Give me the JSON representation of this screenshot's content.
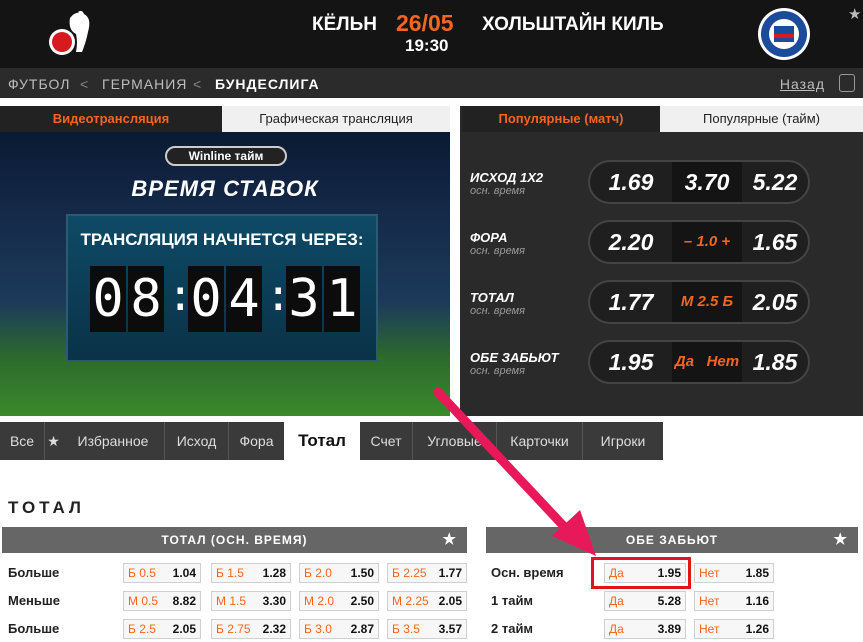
{
  "header": {
    "home_team": "КЁЛЬН",
    "away_team": "ХОЛЬШТАЙН КИЛЬ",
    "date": "26/05",
    "time": "19:30"
  },
  "breadcrumb": {
    "items": [
      "ФУТБОЛ",
      "ГЕРМАНИЯ",
      "БУНДЕСЛИГА"
    ],
    "back": "Назад"
  },
  "video": {
    "tabs": [
      "Видеотрансляция",
      "Графическая трансляция"
    ],
    "winline": "Winline тайм",
    "bet_time": "ВРЕМЯ СТАВОК",
    "countdown_label": "ТРАНСЛЯЦИЯ НАЧНЕТСЯ ЧЕРЕЗ:",
    "digits": [
      "0",
      "8",
      "0",
      "4",
      "3",
      "1"
    ],
    "colon": ":"
  },
  "popular": {
    "tabs": [
      "Популярные (матч)",
      "Популярные (тайм)"
    ],
    "markets": [
      {
        "name": "ИСХОД 1Х2",
        "sub": "осн. время",
        "left": "1.69",
        "mid": "3.70",
        "right": "5.22"
      },
      {
        "name": "ФОРА",
        "sub": "осн. время",
        "left": "2.20",
        "mid": "– 1.0 +",
        "right": "1.65"
      },
      {
        "name": "ТОТАЛ",
        "sub": "осн. время",
        "left": "1.77",
        "mid": "М 2.5 Б",
        "right": "2.05"
      },
      {
        "name": "ОБЕ ЗАБЬЮТ",
        "sub": "осн. время",
        "left": "1.95",
        "mid": "Да   Нет",
        "right": "1.85"
      }
    ]
  },
  "nav": {
    "items": [
      "Все",
      "Избранное",
      "Исход",
      "Фора",
      "Тотал",
      "Счет",
      "Угловые",
      "Карточки",
      "Игроки"
    ],
    "star": "★"
  },
  "section_title": "ТОТАЛ",
  "total_table": {
    "header": "ТОТАЛ (ОСН. ВРЕМЯ)",
    "rows": [
      {
        "label": "Больше",
        "cells": [
          {
            "k": "Б 0.5",
            "v": "1.04"
          },
          {
            "k": "Б 1.5",
            "v": "1.28"
          },
          {
            "k": "Б 2.0",
            "v": "1.50"
          },
          {
            "k": "Б 2.25",
            "v": "1.77"
          }
        ]
      },
      {
        "label": "Меньше",
        "cells": [
          {
            "k": "М 0.5",
            "v": "8.82"
          },
          {
            "k": "М 1.5",
            "v": "3.30"
          },
          {
            "k": "М 2.0",
            "v": "2.50"
          },
          {
            "k": "М 2.25",
            "v": "2.05"
          }
        ]
      },
      {
        "label": "Больше",
        "cells": [
          {
            "k": "Б 2.5",
            "v": "2.05"
          },
          {
            "k": "Б 2.75",
            "v": "2.32"
          },
          {
            "k": "Б 3.0",
            "v": "2.87"
          },
          {
            "k": "Б 3.5",
            "v": "3.57"
          }
        ]
      }
    ]
  },
  "both_table": {
    "header": "ОБЕ ЗАБЬЮТ",
    "rows": [
      {
        "label": "Осн. время",
        "yes_k": "Да",
        "yes_v": "1.95",
        "no_k": "Нет",
        "no_v": "1.85"
      },
      {
        "label": "1 тайм",
        "yes_k": "Да",
        "yes_v": "5.28",
        "no_k": "Нет",
        "no_v": "1.16"
      },
      {
        "label": "2 тайм",
        "yes_k": "Да",
        "yes_v": "3.89",
        "no_k": "Нет",
        "no_v": "1.26"
      }
    ]
  },
  "colors": {
    "accent": "#f26522",
    "highlight": "#e3131a",
    "header_bg": "#141414"
  }
}
